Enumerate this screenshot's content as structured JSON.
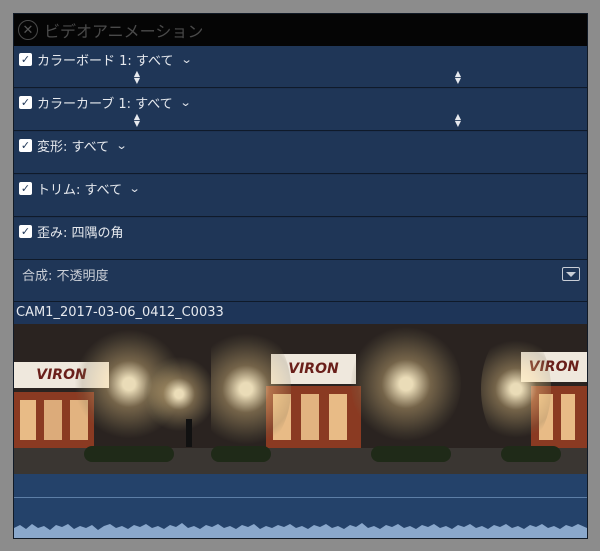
{
  "window": {
    "title": "ビデオアニメーション"
  },
  "effects": [
    {
      "label": "カラーボード 1: すべて",
      "checked": true,
      "has_menu": true,
      "keyframes": true
    },
    {
      "label": "カラーカーブ 1: すべて",
      "checked": true,
      "has_menu": true,
      "keyframes": true
    },
    {
      "label": "変形: すべて",
      "checked": true,
      "has_menu": true,
      "keyframes": false
    },
    {
      "label": "トリム: すべて",
      "checked": true,
      "has_menu": true,
      "keyframes": false
    },
    {
      "label": "歪み: 四隅の角",
      "checked": true,
      "has_menu": false,
      "keyframes": false
    }
  ],
  "composite": {
    "label": "合成: 不透明度"
  },
  "clip": {
    "name": "CAM1_2017-03-06_0412_C0033",
    "sign_text": "VIRON"
  },
  "icons": {
    "close": "close-icon",
    "checkbox": "checkmark-icon",
    "menu": "chevron-down-icon",
    "keyframe": "keyframe-icon",
    "expand": "disclosure-icon"
  },
  "colors": {
    "title_bar": "#050505",
    "panel": "#1f3657",
    "audio": "#24426a",
    "waveform": "#8aa8cc"
  }
}
